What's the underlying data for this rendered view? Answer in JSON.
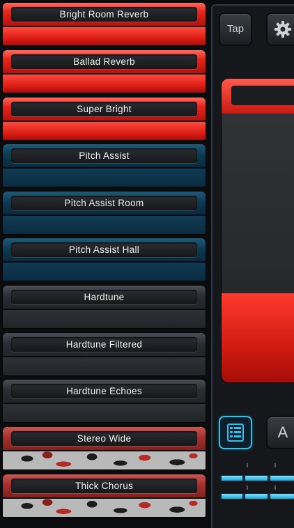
{
  "presets": [
    {
      "label": "Bright Room Reverb",
      "style": "red"
    },
    {
      "label": "Ballad Reverb",
      "style": "red"
    },
    {
      "label": "Super Bright",
      "style": "red"
    },
    {
      "label": "Pitch Assist",
      "style": "blue"
    },
    {
      "label": "Pitch Assist Room",
      "style": "blue"
    },
    {
      "label": "Pitch Assist Hall",
      "style": "blue"
    },
    {
      "label": "Hardtune",
      "style": "gray"
    },
    {
      "label": "Hardtune Filtered",
      "style": "gray"
    },
    {
      "label": "Hardtune Echoes",
      "style": "gray"
    },
    {
      "label": "Stereo Wide",
      "style": "camo"
    },
    {
      "label": "Thick Chorus",
      "style": "camo"
    }
  ],
  "controls": {
    "tap_label": "Tap",
    "settings_icon": "gear-icon",
    "list_icon": "list-icon",
    "a_label": "A"
  },
  "colors": {
    "accent_cyan": "#2bc3f0",
    "red": "#e3251c",
    "blue": "#0f3a52"
  }
}
